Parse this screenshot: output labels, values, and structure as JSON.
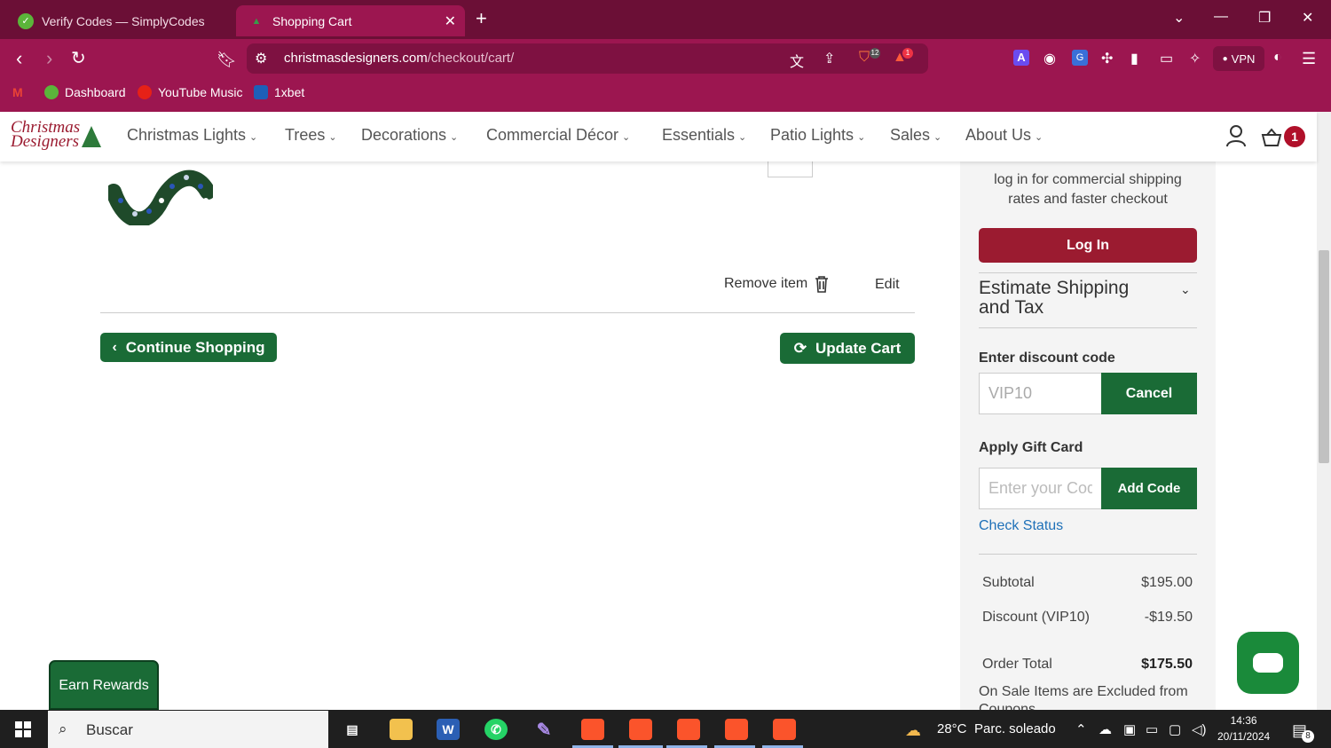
{
  "browser": {
    "tabs": [
      {
        "label": "Verify Codes — SimplyCodes"
      },
      {
        "label": "Shopping Cart"
      }
    ],
    "url_host": "christmasdesigners.com",
    "url_path": "/checkout/cart/",
    "vpn_label": "VPN",
    "bookmarks": [
      {
        "label": "Dashboard"
      },
      {
        "label": "YouTube Music"
      },
      {
        "label": "1xbet"
      }
    ],
    "badges": {
      "brave_shield": "12",
      "rewards": "1"
    }
  },
  "site": {
    "logo_line1": "Christmas",
    "logo_line2": "Designers",
    "nav": [
      {
        "label": "Christmas Lights"
      },
      {
        "label": "Trees"
      },
      {
        "label": "Decorations"
      },
      {
        "label": "Commercial Décor"
      },
      {
        "label": "Essentials"
      },
      {
        "label": "Patio Lights"
      },
      {
        "label": "Sales"
      },
      {
        "label": "About Us"
      }
    ],
    "cart_count": "1"
  },
  "cart": {
    "remove_item_label": "Remove item",
    "edit_label": "Edit",
    "continue_label": "Continue Shopping",
    "update_label": "Update Cart"
  },
  "sidebar": {
    "login_prompt": "log in for commercial shipping rates and faster checkout",
    "login_label": "Log In",
    "estimate_label": "Estimate Shipping and Tax",
    "discount_heading": "Enter discount code",
    "discount_value": "VIP10",
    "cancel_label": "Cancel",
    "gift_heading": "Apply Gift Card",
    "gift_placeholder": "Enter your Code",
    "add_code_label": "Add Code",
    "check_status_label": "Check Status",
    "subtotal_label": "Subtotal",
    "subtotal_value": "$195.00",
    "discount_label": "Discount (VIP10)",
    "discount_amount": "-$19.50",
    "order_total_label": "Order Total",
    "order_total_value": "$175.50",
    "excluded_note": "On Sale Items are Excluded from Coupons"
  },
  "widgets": {
    "earn_rewards_label": "Earn Rewards"
  },
  "taskbar": {
    "search_label": "Buscar",
    "weather_temp": "28°C",
    "weather_desc": "Parc. soleado",
    "time": "14:36",
    "date": "20/11/2024",
    "notification_count": "8"
  },
  "colors": {
    "brand_green": "#1a6b36",
    "brand_red": "#9b1b30",
    "browser_tabbar": "#6b0f36",
    "browser_toolbar": "#9c1650",
    "link_blue": "#1e70b8"
  }
}
